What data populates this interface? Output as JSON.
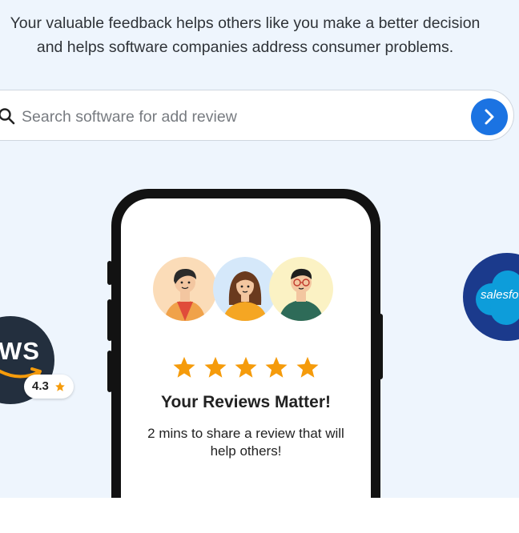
{
  "intro": {
    "line1": "Your valuable feedback helps others like you make a better decision",
    "line2": "and helps software companies address consumer problems."
  },
  "search": {
    "placeholder": "Search software for add review",
    "icon": "search-icon",
    "submit_icon": "chevron-right-icon"
  },
  "phone_card": {
    "rating_stars": 5,
    "title": "Your Reviews Matter!",
    "subtitle": "2 mins to share a review that will help others!"
  },
  "logos": {
    "aws": {
      "text": "WS",
      "rating": "4.3"
    },
    "salesforce": {
      "text": "salesfo"
    }
  },
  "colors": {
    "background": "#eef5fd",
    "accent": "#1b73e2",
    "star": "#f59b0b",
    "aws": "#232f3e",
    "salesforce": "#1b3a8c"
  }
}
